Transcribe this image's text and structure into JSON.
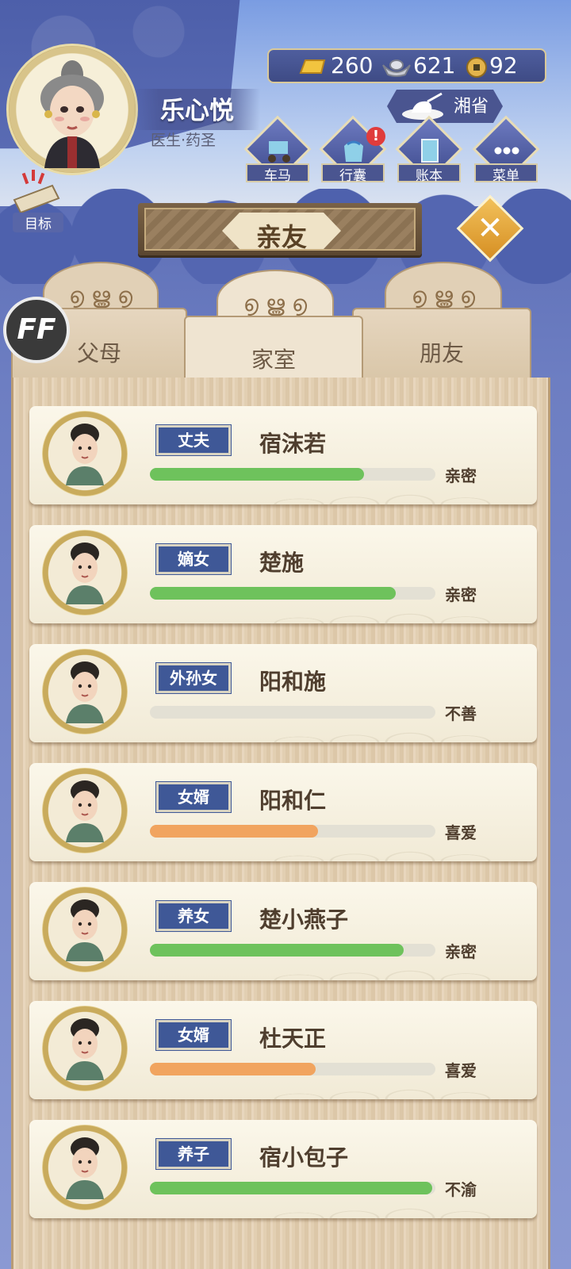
{
  "player": {
    "name": "乐心悦",
    "title": "医生·药圣"
  },
  "currency": {
    "gold": "260",
    "silver": "621",
    "coin": "92"
  },
  "region": {
    "label": "湘省"
  },
  "nav": [
    {
      "label": "车马",
      "icon": "carriage-icon",
      "alert": false
    },
    {
      "label": "行囊",
      "icon": "bag-icon",
      "alert": true
    },
    {
      "label": "账本",
      "icon": "ledger-icon",
      "alert": false
    },
    {
      "label": "菜单",
      "icon": "menu-icon",
      "alert": false
    }
  ],
  "goal": {
    "label": "目标"
  },
  "page": {
    "title": "亲友"
  },
  "tabs": [
    {
      "label": "父母",
      "active": false
    },
    {
      "label": "家室",
      "active": true
    },
    {
      "label": "朋友",
      "active": false
    }
  ],
  "overlay_badge": "FF",
  "colors": {
    "good": "#6ec25c",
    "warm": "#f1a45f",
    "tag": "#3f5897"
  },
  "relatives": [
    {
      "relation": "丈夫",
      "name": "宿沫若",
      "status": "亲密",
      "bar": 0.75,
      "bar_color": "#6ec25c"
    },
    {
      "relation": "嫡女",
      "name": "楚施",
      "status": "亲密",
      "bar": 0.86,
      "bar_color": "#6ec25c"
    },
    {
      "relation": "外孙女",
      "name": "阳和施",
      "status": "不善",
      "bar": 0.0,
      "bar_color": "#6ec25c"
    },
    {
      "relation": "女婿",
      "name": "阳和仁",
      "status": "喜爱",
      "bar": 0.59,
      "bar_color": "#f1a45f"
    },
    {
      "relation": "养女",
      "name": "楚小燕子",
      "status": "亲密",
      "bar": 0.89,
      "bar_color": "#6ec25c"
    },
    {
      "relation": "女婿",
      "name": "杜天正",
      "status": "喜爱",
      "bar": 0.58,
      "bar_color": "#f1a45f"
    },
    {
      "relation": "养子",
      "name": "宿小包子",
      "status": "不渝",
      "bar": 0.99,
      "bar_color": "#6ec25c"
    }
  ]
}
